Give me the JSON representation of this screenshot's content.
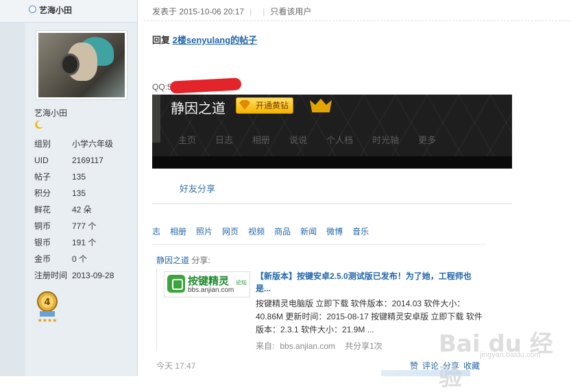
{
  "user": {
    "name_top": "艺海小田",
    "name": "艺海小田",
    "stats": [
      {
        "k": "组别",
        "v": "小学六年级"
      },
      {
        "k": "UID",
        "v": "2169117"
      },
      {
        "k": "帖子",
        "v": "135"
      },
      {
        "k": "积分",
        "v": "135"
      },
      {
        "k": "鲜花",
        "v": "42 朵"
      },
      {
        "k": "铜币",
        "v": "777 个"
      },
      {
        "k": "银币",
        "v": "191 个"
      },
      {
        "k": "金币",
        "v": "0 个"
      },
      {
        "k": "注册时间",
        "v": "2013-09-28"
      }
    ]
  },
  "post": {
    "meta": "发表于 2015-10-06 20:17",
    "only_user": "只看该用户",
    "reply_prefix": "回复",
    "reply_link": "2楼senyulang的帖子",
    "qq_label": "QQ:57350"
  },
  "qzone": {
    "title": "静因之道",
    "vip_label": "开通黄钻",
    "nav": [
      "主页",
      "日志",
      "相册",
      "说说",
      "个人档",
      "时光轴",
      "更多"
    ]
  },
  "friend_share": "好友分享",
  "tabs": [
    "志",
    "相册",
    "照片",
    "网页",
    "视频",
    "商品",
    "新闻",
    "微博",
    "音乐"
  ],
  "share": {
    "who": "静因之道",
    "action": "分享:",
    "logo_brand": "按键精灵",
    "logo_forum": "论坛",
    "logo_url": "bbs.anjian.com",
    "title": "【新版本】按键安卓2.5.0测试版已发布！为了她，工程师也是...",
    "body": "按键精灵电脑版 立即下载 软件版本：2014.03 软件大小：40.86M 更新时间：2015-08-17 按键精灵安卓版 立即下载 软件版本：2.3.1 软件大小：21.9M ...",
    "source_label": "来自:",
    "source_domain": "bbs.anjian.com",
    "share_count": "共分享1次",
    "time": "今天 17:47",
    "actions": [
      "赞",
      "评论",
      "分享",
      "收藏"
    ]
  },
  "watermark": {
    "main": "Bai du 经验",
    "sub": "jingyan.baidu.com"
  }
}
